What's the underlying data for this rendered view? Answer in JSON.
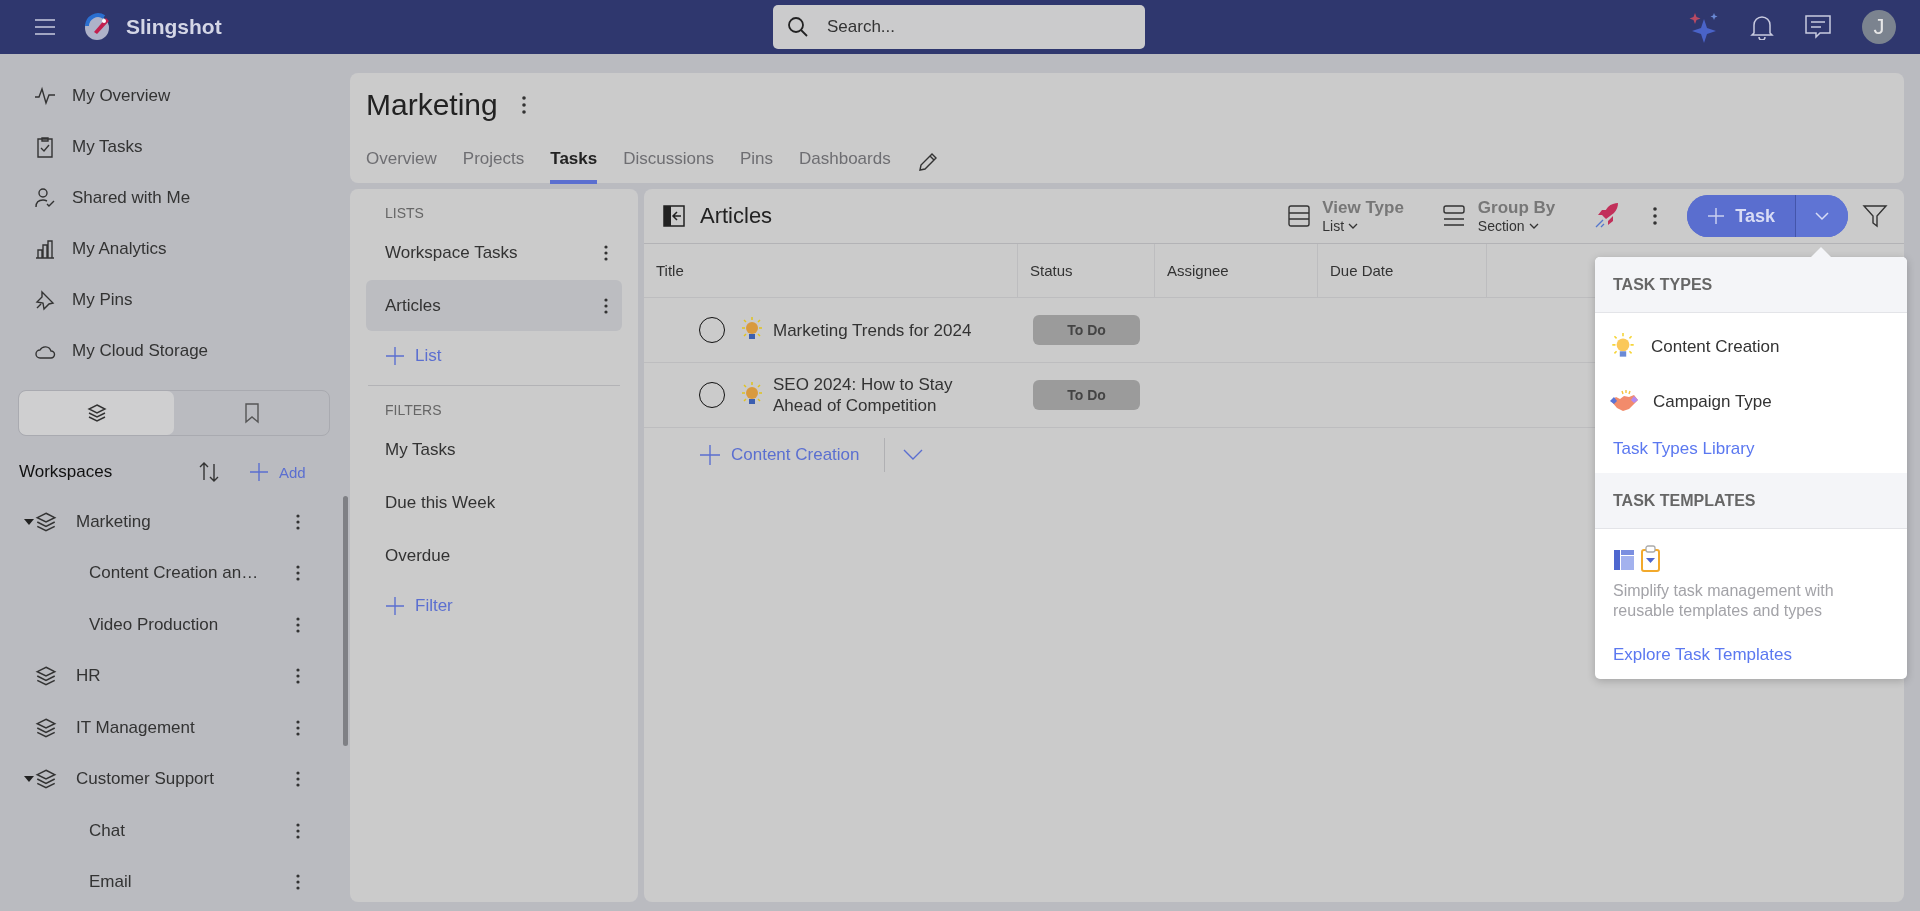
{
  "topbar": {
    "app_name": "Slingshot",
    "search_placeholder": "Search...",
    "avatar": "J"
  },
  "sidebar": {
    "items": [
      {
        "kind": "overview",
        "label": "My Overview"
      },
      {
        "kind": "tasks",
        "label": "My Tasks"
      },
      {
        "kind": "shared",
        "label": "Shared with Me"
      },
      {
        "kind": "analytics",
        "label": "My Analytics"
      },
      {
        "kind": "pins",
        "label": "My Pins"
      },
      {
        "kind": "cloud",
        "label": "My Cloud Storage"
      }
    ],
    "tabs": [
      {
        "kind": "workspaces",
        "selected": true
      },
      {
        "kind": "bookmarks",
        "selected": false
      }
    ],
    "workspaces_title": "Workspaces",
    "add_label": "Add",
    "tree": [
      {
        "label": "Marketing",
        "expanded": true,
        "children": [
          {
            "label": "Content Creation an…"
          },
          {
            "label": "Video Production"
          }
        ]
      },
      {
        "label": "HR",
        "expanded": false
      },
      {
        "label": "IT Management",
        "expanded": false
      },
      {
        "label": "Customer Support",
        "expanded": true,
        "children": [
          {
            "label": "Chat"
          },
          {
            "label": "Email"
          }
        ]
      }
    ]
  },
  "header": {
    "title": "Marketing",
    "tabs": [
      {
        "label": "Overview",
        "selected": false
      },
      {
        "label": "Projects",
        "selected": false
      },
      {
        "label": "Tasks",
        "selected": true
      },
      {
        "label": "Discussions",
        "selected": false
      },
      {
        "label": "Pins",
        "selected": false
      },
      {
        "label": "Dashboards",
        "selected": false
      }
    ]
  },
  "lists_panel": {
    "lists_heading": "LISTS",
    "lists": [
      {
        "label": "Workspace Tasks",
        "selected": false
      },
      {
        "label": "Articles",
        "selected": true
      }
    ],
    "add_list": "List",
    "filters_heading": "FILTERS",
    "filters": [
      "My Tasks",
      "Due this Week",
      "Overdue"
    ],
    "add_filter": "Filter"
  },
  "task_view": {
    "title": "Articles",
    "view_type": {
      "label": "View Type",
      "value": "List"
    },
    "group_by": {
      "label": "Group By",
      "value": "Section"
    },
    "add_button": "Task",
    "columns": [
      "Title",
      "Status",
      "Assignee",
      "Due Date"
    ],
    "rows": [
      {
        "title": "Marketing Trends for 2024",
        "status": "To Do",
        "done": false
      },
      {
        "title": "SEO 2024: How to Stay Ahead of Competition",
        "status": "To Do",
        "done": false
      }
    ],
    "add_row": "Content Creation"
  },
  "dropdown": {
    "types_heading": "TASK TYPES",
    "types": [
      {
        "kind": "bulb",
        "label": "Content Creation"
      },
      {
        "kind": "handshake",
        "label": "Campaign Type"
      }
    ],
    "types_link": "Task Types Library",
    "templates_heading": "TASK TEMPLATES",
    "templates_text": "Simplify task management with reusable templates and types",
    "templates_link": "Explore Task Templates"
  }
}
